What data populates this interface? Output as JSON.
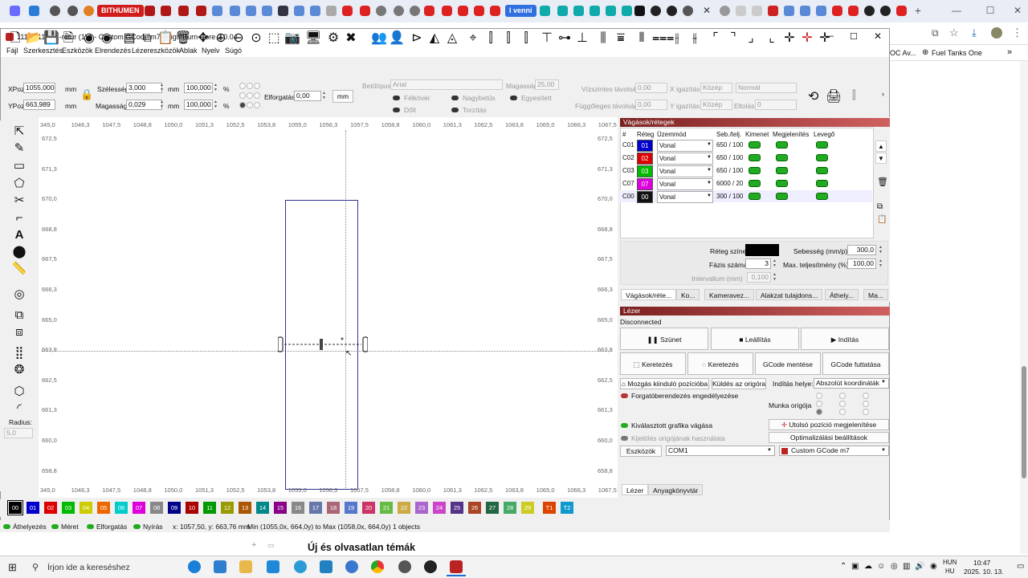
{
  "browser": {
    "badge1": "BITHUMEN",
    "badge2": "l venni",
    "bookmark1": "OC Av...",
    "bookmark2": "Fuel Tanks One",
    "bookmark_more": "»",
    "below_text": "Új és olvasatlan témák"
  },
  "app": {
    "title": "111111111111-retur (1) * - Custom GCode m7 - LightBurn Core 2.0.04",
    "menu": [
      "Fájl",
      "Szerkesztés",
      "Eszközök",
      "Elrendezés",
      "Lézereszközök",
      "Ablak",
      "Nyelv",
      "Súgó"
    ]
  },
  "props": {
    "xpos_label": "XPoz",
    "xpos": "1055,000",
    "ypos_label": "YPoz",
    "ypos": "663,989",
    "unit": "mm",
    "width_label": "Szélesség",
    "width": "3,000",
    "height_label": "Magasság",
    "height": "0,029",
    "pct1": "100,000",
    "pct2": "100,000",
    "pct": "%",
    "rotate_label": "Elforgatás",
    "rotate": "0,00",
    "mm_btn": "mm",
    "font_label": "Betűtípus",
    "font": "Arial",
    "size_label": "Magasság",
    "size": "25,00",
    "bold": "Félkövér",
    "upper": "Nagybetűs",
    "italic": "Dőlt",
    "distort": "Torzítás",
    "weld": "Egyesített",
    "hspace_label": "Vízszintes távolság",
    "hspace": "0,00",
    "vspace_label": "Függőleges távolság",
    "vspace": "0,00",
    "xalign_label": "X igazítás",
    "xalign": "Közép",
    "yalign_label": "Y igazítás",
    "yalign": "Közép",
    "mode": "Normál",
    "offset_label": "Eltolás",
    "offset": "0"
  },
  "left": {
    "radius_label": "Radius:",
    "radius": "5,0"
  },
  "ruler": {
    "top": [
      "345,0",
      "1046,3",
      "1047,5",
      "1048,8",
      "1050,0",
      "1051,3",
      "1052,5",
      "1053,8",
      "1055,0",
      "1056,3",
      "1057,5",
      "1058,8",
      "1060,0",
      "1061,3",
      "1062,5",
      "1063,8",
      "1065,0",
      "1066,3",
      "1067,5"
    ],
    "left": [
      "672,5",
      "671,3",
      "670,0",
      "668,8",
      "667,5",
      "666,3",
      "665,0",
      "663,8",
      "662,5",
      "661,3",
      "660,0",
      "658,8"
    ]
  },
  "palette": [
    "00",
    "01",
    "02",
    "03",
    "04",
    "05",
    "06",
    "07",
    "08",
    "09",
    "10",
    "11",
    "12",
    "13",
    "14",
    "15",
    "16",
    "17",
    "18",
    "19",
    "20",
    "21",
    "22",
    "23",
    "24",
    "25",
    "26",
    "27",
    "28",
    "29",
    "T1",
    "T2"
  ],
  "palette_colors": [
    "#000000",
    "#0000cc",
    "#dd0000",
    "#00bb00",
    "#cccc00",
    "#ee6600",
    "#00cccc",
    "#dd00dd",
    "#888888",
    "#000088",
    "#aa0000",
    "#009900",
    "#999900",
    "#aa5500",
    "#008888",
    "#880088",
    "#888888",
    "#6677aa",
    "#aa6677",
    "#5577cc",
    "#cc3366",
    "#66bb44",
    "#ccaa44",
    "#aa66cc",
    "#cc44cc",
    "#553388",
    "#aa4422",
    "#226644",
    "#44aa66",
    "#cccc22",
    "#dd4400",
    "#1199cc"
  ],
  "status": {
    "move": "Áthelyezés",
    "size": "Méret",
    "rotate": "Elforgatás",
    "shear": "Nyírás",
    "coords": "x: 1057,50, y: 663,76 mm",
    "range": "Min (1055,0x, 664,0y) to Max (1058,0x, 664,0y)  1 objects"
  },
  "layers": {
    "title": "Vágások/rétegek",
    "headers": [
      "#",
      "Réteg",
      "Üzemmód",
      "Seb./telj.",
      "Kimenet",
      "Megjelenítés",
      "Levegő"
    ],
    "rows": [
      {
        "id": "C01",
        "num": "01",
        "color": "#0000cc",
        "mode": "Vonal",
        "speed": "650 / 100"
      },
      {
        "id": "C02",
        "num": "02",
        "color": "#dd0000",
        "mode": "Vonal",
        "speed": "650 / 100"
      },
      {
        "id": "C03",
        "num": "03",
        "color": "#00bb00",
        "mode": "Vonal",
        "speed": "650 / 100"
      },
      {
        "id": "C07",
        "num": "07",
        "color": "#dd00dd",
        "mode": "Vonal",
        "speed": "6000 / 20"
      },
      {
        "id": "C00",
        "num": "00",
        "color": "#111111",
        "mode": "Vonal",
        "speed": "300 / 100"
      }
    ],
    "color_label": "Réteg színe",
    "speed_label": "Sebesség (mm/p)",
    "speed": "300,0",
    "passes_label": "Fázis száma",
    "passes": "3",
    "power_label": "Max. teljesítmény (%)",
    "power": "100,00",
    "interval_label": "Intervallum (mm)",
    "interval": "0,100",
    "tabs": [
      "Vágások/réte...",
      "Ko...",
      "Kameravez...",
      "Alakzat tulajdons...",
      "Áthely...",
      "Ma..."
    ]
  },
  "laser": {
    "title": "Lézer",
    "state": "Disconnected",
    "pause": "Szünet",
    "stop": "Leállítás",
    "start": "Indítás",
    "frame1": "Keretezés",
    "frame2": "Keretezés",
    "save": "GCode mentése",
    "run": "GCode futtatása",
    "home": "Mozgás kiinduló pozícióba",
    "origin": "Küldés az origóra",
    "start_from_label": "Indítás helye:",
    "start_from": "Abszolút koordináták",
    "rotary": "Forgatóberendezés engedélyezése",
    "job_origin": "Munka origója",
    "cut_selected": "Kiválasztott grafika vágása",
    "use_origin": "Kijelölés origójának használata",
    "last_pos": "Utolsó pozíció megjelenítése",
    "optimize": "Optimalizálási beállítások",
    "devices": "Eszközök",
    "port": "COM1",
    "device": "Custom GCode m7",
    "tabs": [
      "Lézer",
      "Anyagkönyvtár"
    ]
  },
  "taskbar": {
    "search": "Írjon ide a kereséshez",
    "lang1": "HUN",
    "lang2": "HU",
    "time": "10:47",
    "date": "2025. 10. 13."
  }
}
